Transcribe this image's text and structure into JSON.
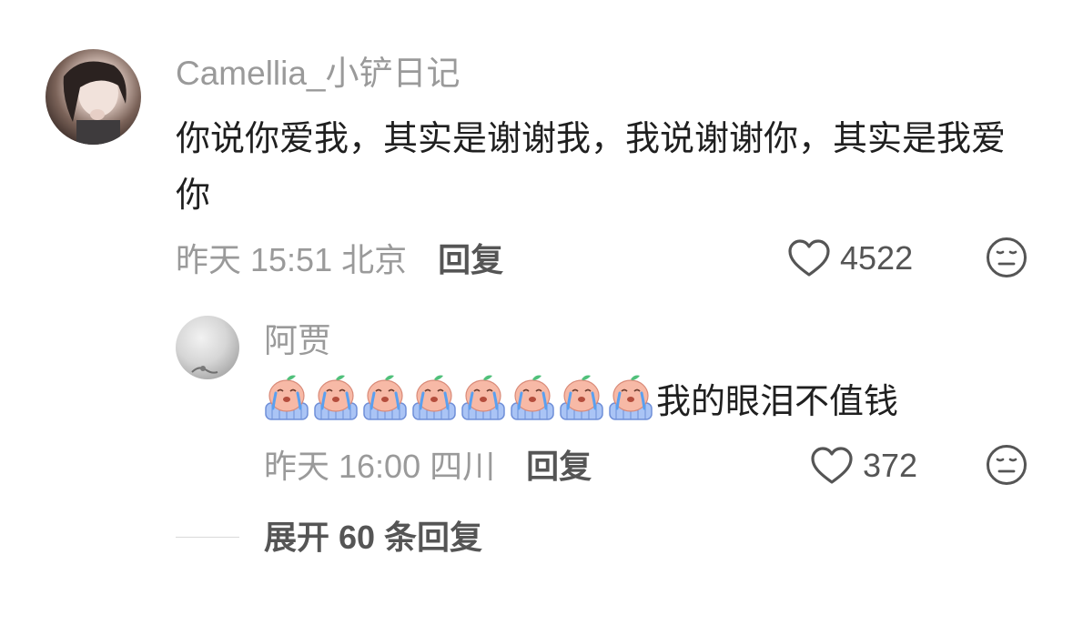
{
  "comment": {
    "username": "Camellia_小铲日记",
    "text": "你说你爱我，其实是谢谢我，我说谢谢你，其实是我爱你",
    "time": "昨天 15:51 北京",
    "reply_label": "回复",
    "likes": "4522",
    "icons": [
      "heart-outline-icon",
      "dislike-face-icon"
    ]
  },
  "reply": {
    "username": "阿贾",
    "emoji_name": "crying-baby-emoji",
    "emoji_count": 8,
    "text": "我的眼泪不值钱",
    "time": "昨天 16:00 四川",
    "reply_label": "回复",
    "likes": "372",
    "icons": [
      "heart-outline-icon",
      "dislike-face-icon"
    ]
  },
  "expand": {
    "label": "展开 60 条回复"
  },
  "colors": {
    "username": "#9a9a9a",
    "body_text": "#1f1f1f",
    "meta_text": "#9a9a9a",
    "action_text": "#555555",
    "icon_stroke": "#555555"
  }
}
